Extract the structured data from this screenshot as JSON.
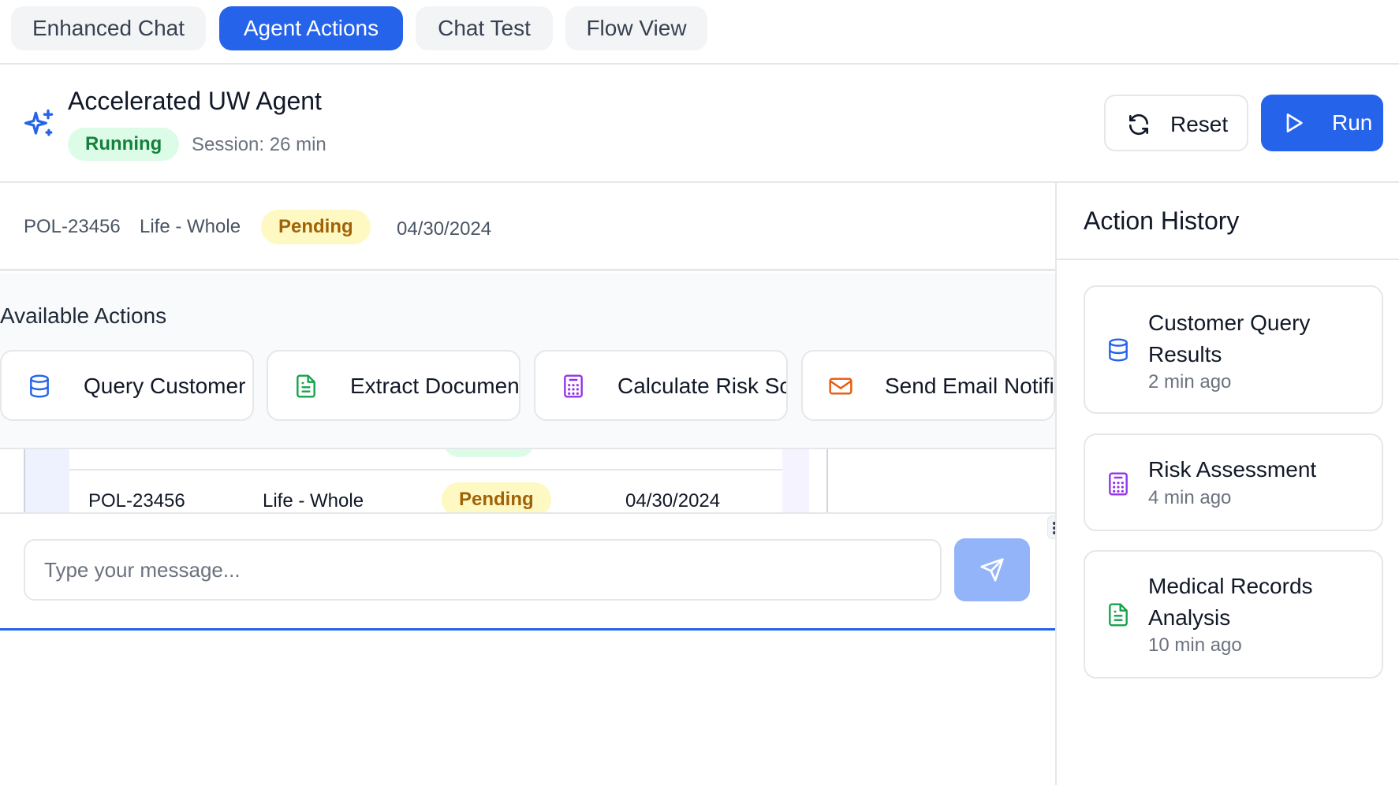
{
  "tabs": [
    {
      "label": "Enhanced Chat",
      "active": false
    },
    {
      "label": "Agent Actions",
      "active": true
    },
    {
      "label": "Chat Test",
      "active": false
    },
    {
      "label": "Flow View",
      "active": false
    }
  ],
  "agent": {
    "title": "Accelerated UW Agent",
    "status": "Running",
    "session": "Session: 26 min",
    "reset_label": "Reset",
    "run_label": "Run"
  },
  "record": {
    "policy": "POL-23456",
    "type": "Life - Whole",
    "status": "Pending",
    "date": "04/30/2024"
  },
  "actions": {
    "title": "Available Actions",
    "items": [
      {
        "label": "Query Customer Data",
        "icon": "database-icon",
        "color": "#2563eb"
      },
      {
        "label": "Extract Document Data",
        "icon": "document-icon",
        "color": "#16a34a"
      },
      {
        "label": "Calculate Risk Score",
        "icon": "calculator-icon",
        "color": "#9333ea"
      },
      {
        "label": "Send Email Notification",
        "icon": "mail-icon",
        "color": "#ea580c"
      }
    ]
  },
  "table_row": {
    "policy": "POL-23456",
    "type": "Life - Whole",
    "status": "Pending",
    "date": "04/30/2024"
  },
  "chat": {
    "placeholder": "Type your message..."
  },
  "history": {
    "title": "Action History",
    "items": [
      {
        "title": "Customer Query Results",
        "time": "2 min ago",
        "icon": "database-icon"
      },
      {
        "title": "Risk Assessment",
        "time": "4 min ago",
        "icon": "calculator-icon"
      },
      {
        "title": "Medical Records Analysis",
        "time": "10 min ago",
        "icon": "document-icon"
      }
    ]
  },
  "colors": {
    "accent": "#2563eb",
    "running_bg": "#dcfce7",
    "running_text": "#15803d",
    "pending_bg": "#fef9c3",
    "pending_text": "#a16207"
  }
}
